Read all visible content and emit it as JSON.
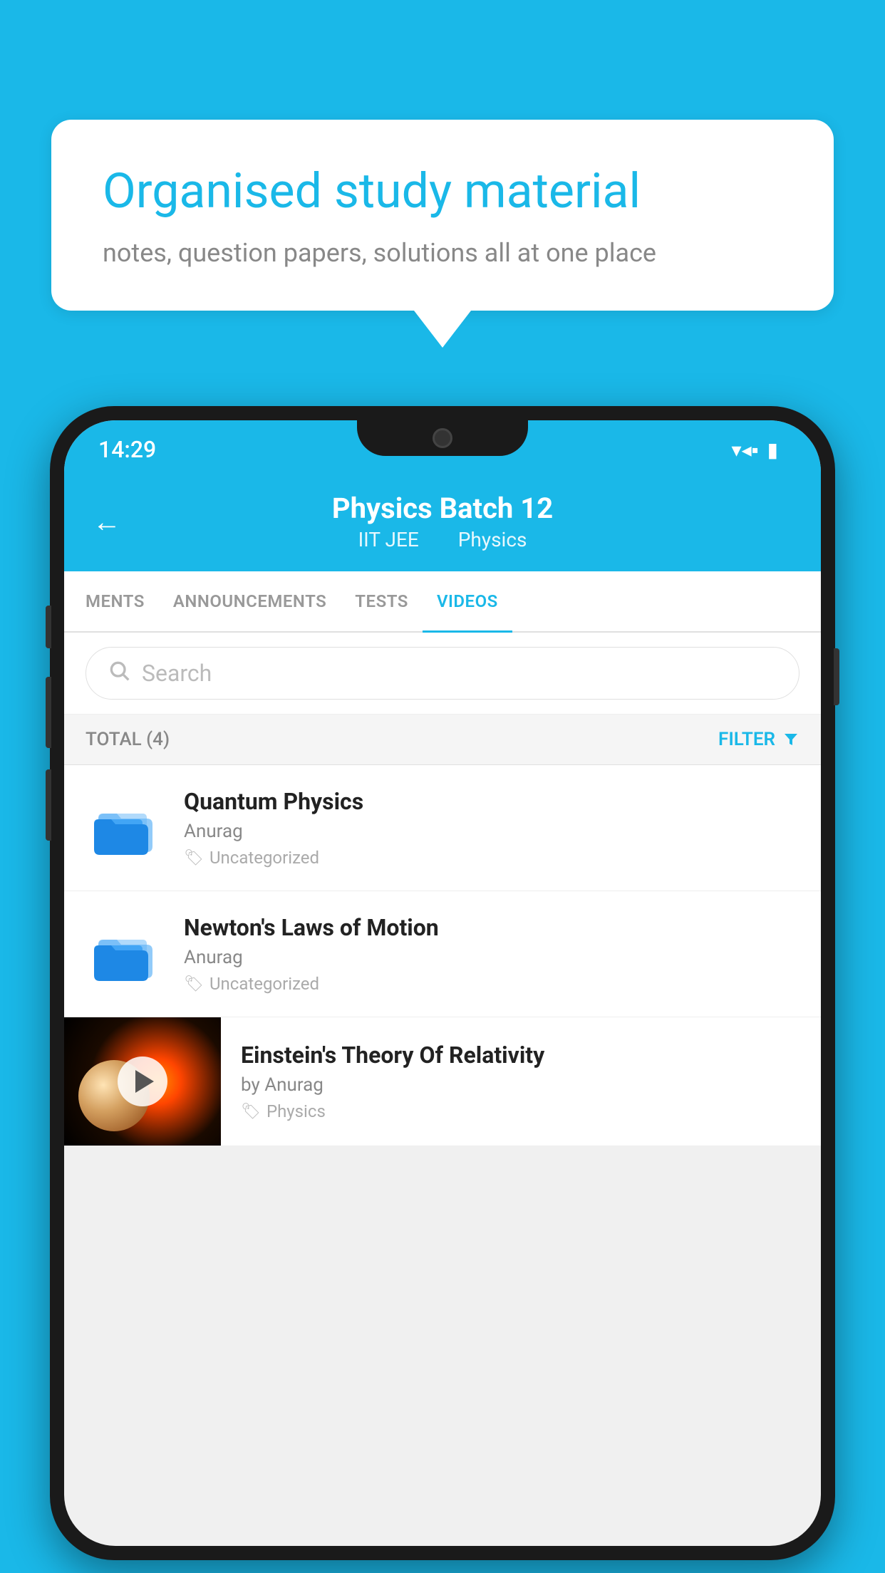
{
  "background": {
    "color": "#1ab8e8"
  },
  "speechBubble": {
    "title": "Organised study material",
    "subtitle": "notes, question papers, solutions all at one place"
  },
  "statusBar": {
    "time": "14:29",
    "icons": [
      "wifi",
      "signal",
      "battery"
    ]
  },
  "header": {
    "title": "Physics Batch 12",
    "subtitle1": "IIT JEE",
    "subtitle2": "Physics",
    "back_label": "←"
  },
  "tabs": [
    {
      "label": "MENTS",
      "active": false
    },
    {
      "label": "ANNOUNCEMENTS",
      "active": false
    },
    {
      "label": "TESTS",
      "active": false
    },
    {
      "label": "VIDEOS",
      "active": true
    }
  ],
  "search": {
    "placeholder": "Search"
  },
  "filterBar": {
    "totalLabel": "TOTAL (4)",
    "filterLabel": "FILTER"
  },
  "videoList": [
    {
      "type": "folder",
      "title": "Quantum Physics",
      "author": "Anurag",
      "tag": "Uncategorized"
    },
    {
      "type": "folder",
      "title": "Newton's Laws of Motion",
      "author": "Anurag",
      "tag": "Uncategorized"
    },
    {
      "type": "thumbnail",
      "title": "Einstein's Theory Of Relativity",
      "author": "by Anurag",
      "tag": "Physics"
    }
  ]
}
